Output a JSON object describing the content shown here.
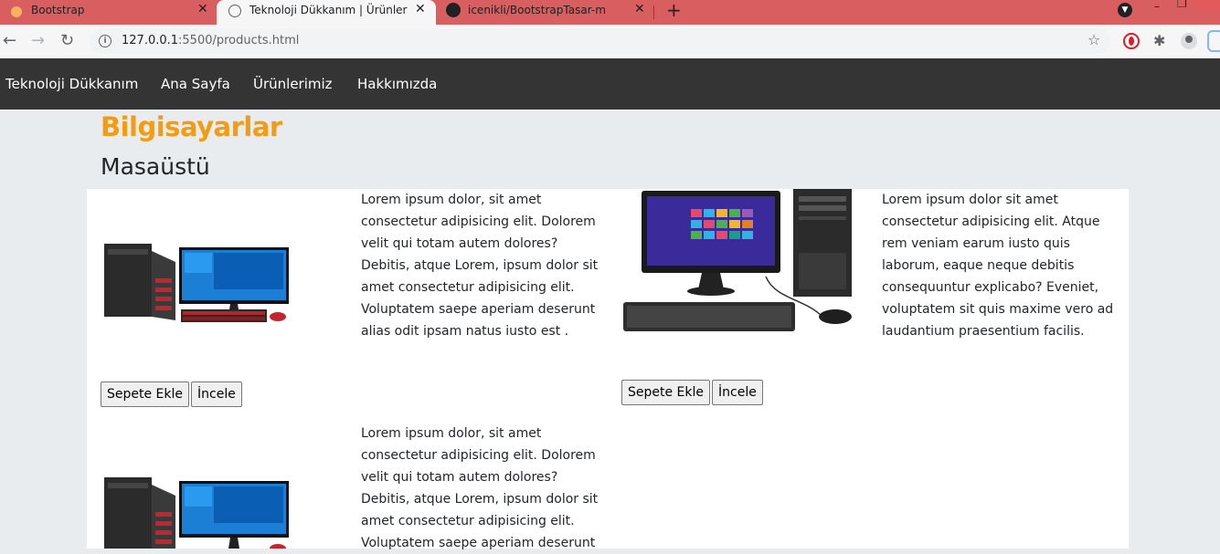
{
  "browser": {
    "tabs": [
      {
        "title": "Bootstrap",
        "close": "✕",
        "active": false
      },
      {
        "title": "Teknoloji Dükkanım | Ürünler",
        "close": "✕",
        "active": true
      },
      {
        "title": "icenikli/BootstrapTasar-m",
        "close": "✕",
        "active": false
      }
    ],
    "new_tab": "+",
    "url_host": "127.0.0.1",
    "url_path": ":5500/products.html"
  },
  "navbar": {
    "brand": "Teknoloji Dükkanım",
    "links": [
      "Ana Sayfa",
      "Ürünlerimiz",
      "Hakkımızda"
    ]
  },
  "page": {
    "title": "Bilgisayarlar",
    "subtitle": "Masaüstü"
  },
  "products": [
    {
      "description": "Lorem ipsum dolor, sit amet consectetur adipisicing elit. Dolorem velit qui totam autem dolores? Debitis, atque Lorem, ipsum dolor sit amet consectetur adipisicing elit. Voluptatem saepe aperiam deserunt alias odit ipsam natus iusto est .",
      "add_to_cart": "Sepete Ekle",
      "inspect": "İncele"
    },
    {
      "description": "Lorem ipsum dolor sit amet consectetur adipisicing elit. Atque rem veniam earum iusto quis laborum, eaque neque debitis consequuntur explicabo? Eveniet, voluptatem sit quis maxime vero ad laudantium praesentium facilis.",
      "add_to_cart": "Sepete Ekle",
      "inspect": "İncele"
    },
    {
      "description": "Lorem ipsum dolor, sit amet consectetur adipisicing elit. Dolorem velit qui totam autem dolores? Debitis, atque Lorem, ipsum dolor sit amet consectetur adipisicing elit. Voluptatem saepe aperiam deserunt"
    }
  ]
}
